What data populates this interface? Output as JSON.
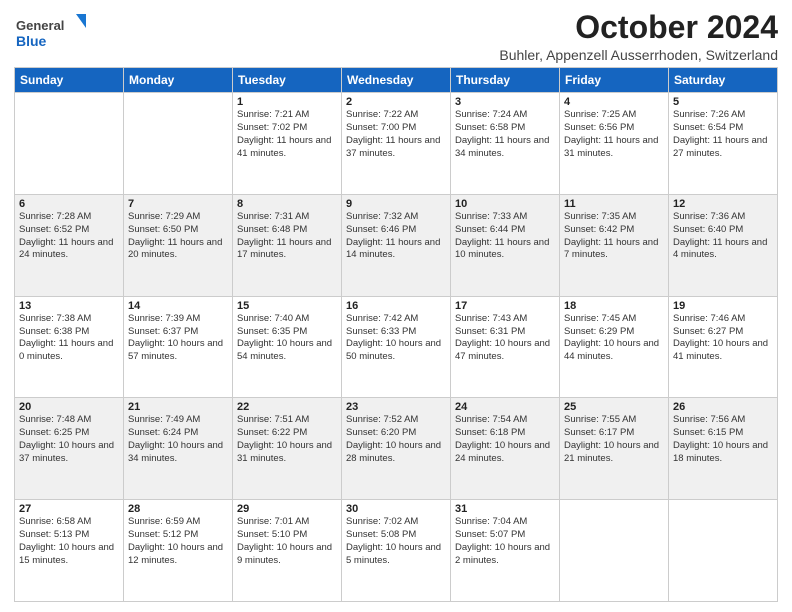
{
  "header": {
    "logo_general": "General",
    "logo_blue": "Blue",
    "month_title": "October 2024",
    "location": "Buhler, Appenzell Ausserrhoden, Switzerland"
  },
  "weekdays": [
    "Sunday",
    "Monday",
    "Tuesday",
    "Wednesday",
    "Thursday",
    "Friday",
    "Saturday"
  ],
  "weeks": [
    [
      {
        "day": "",
        "info": ""
      },
      {
        "day": "",
        "info": ""
      },
      {
        "day": "1",
        "info": "Sunrise: 7:21 AM\nSunset: 7:02 PM\nDaylight: 11 hours and 41 minutes."
      },
      {
        "day": "2",
        "info": "Sunrise: 7:22 AM\nSunset: 7:00 PM\nDaylight: 11 hours and 37 minutes."
      },
      {
        "day": "3",
        "info": "Sunrise: 7:24 AM\nSunset: 6:58 PM\nDaylight: 11 hours and 34 minutes."
      },
      {
        "day": "4",
        "info": "Sunrise: 7:25 AM\nSunset: 6:56 PM\nDaylight: 11 hours and 31 minutes."
      },
      {
        "day": "5",
        "info": "Sunrise: 7:26 AM\nSunset: 6:54 PM\nDaylight: 11 hours and 27 minutes."
      }
    ],
    [
      {
        "day": "6",
        "info": "Sunrise: 7:28 AM\nSunset: 6:52 PM\nDaylight: 11 hours and 24 minutes."
      },
      {
        "day": "7",
        "info": "Sunrise: 7:29 AM\nSunset: 6:50 PM\nDaylight: 11 hours and 20 minutes."
      },
      {
        "day": "8",
        "info": "Sunrise: 7:31 AM\nSunset: 6:48 PM\nDaylight: 11 hours and 17 minutes."
      },
      {
        "day": "9",
        "info": "Sunrise: 7:32 AM\nSunset: 6:46 PM\nDaylight: 11 hours and 14 minutes."
      },
      {
        "day": "10",
        "info": "Sunrise: 7:33 AM\nSunset: 6:44 PM\nDaylight: 11 hours and 10 minutes."
      },
      {
        "day": "11",
        "info": "Sunrise: 7:35 AM\nSunset: 6:42 PM\nDaylight: 11 hours and 7 minutes."
      },
      {
        "day": "12",
        "info": "Sunrise: 7:36 AM\nSunset: 6:40 PM\nDaylight: 11 hours and 4 minutes."
      }
    ],
    [
      {
        "day": "13",
        "info": "Sunrise: 7:38 AM\nSunset: 6:38 PM\nDaylight: 11 hours and 0 minutes."
      },
      {
        "day": "14",
        "info": "Sunrise: 7:39 AM\nSunset: 6:37 PM\nDaylight: 10 hours and 57 minutes."
      },
      {
        "day": "15",
        "info": "Sunrise: 7:40 AM\nSunset: 6:35 PM\nDaylight: 10 hours and 54 minutes."
      },
      {
        "day": "16",
        "info": "Sunrise: 7:42 AM\nSunset: 6:33 PM\nDaylight: 10 hours and 50 minutes."
      },
      {
        "day": "17",
        "info": "Sunrise: 7:43 AM\nSunset: 6:31 PM\nDaylight: 10 hours and 47 minutes."
      },
      {
        "day": "18",
        "info": "Sunrise: 7:45 AM\nSunset: 6:29 PM\nDaylight: 10 hours and 44 minutes."
      },
      {
        "day": "19",
        "info": "Sunrise: 7:46 AM\nSunset: 6:27 PM\nDaylight: 10 hours and 41 minutes."
      }
    ],
    [
      {
        "day": "20",
        "info": "Sunrise: 7:48 AM\nSunset: 6:25 PM\nDaylight: 10 hours and 37 minutes."
      },
      {
        "day": "21",
        "info": "Sunrise: 7:49 AM\nSunset: 6:24 PM\nDaylight: 10 hours and 34 minutes."
      },
      {
        "day": "22",
        "info": "Sunrise: 7:51 AM\nSunset: 6:22 PM\nDaylight: 10 hours and 31 minutes."
      },
      {
        "day": "23",
        "info": "Sunrise: 7:52 AM\nSunset: 6:20 PM\nDaylight: 10 hours and 28 minutes."
      },
      {
        "day": "24",
        "info": "Sunrise: 7:54 AM\nSunset: 6:18 PM\nDaylight: 10 hours and 24 minutes."
      },
      {
        "day": "25",
        "info": "Sunrise: 7:55 AM\nSunset: 6:17 PM\nDaylight: 10 hours and 21 minutes."
      },
      {
        "day": "26",
        "info": "Sunrise: 7:56 AM\nSunset: 6:15 PM\nDaylight: 10 hours and 18 minutes."
      }
    ],
    [
      {
        "day": "27",
        "info": "Sunrise: 6:58 AM\nSunset: 5:13 PM\nDaylight: 10 hours and 15 minutes."
      },
      {
        "day": "28",
        "info": "Sunrise: 6:59 AM\nSunset: 5:12 PM\nDaylight: 10 hours and 12 minutes."
      },
      {
        "day": "29",
        "info": "Sunrise: 7:01 AM\nSunset: 5:10 PM\nDaylight: 10 hours and 9 minutes."
      },
      {
        "day": "30",
        "info": "Sunrise: 7:02 AM\nSunset: 5:08 PM\nDaylight: 10 hours and 5 minutes."
      },
      {
        "day": "31",
        "info": "Sunrise: 7:04 AM\nSunset: 5:07 PM\nDaylight: 10 hours and 2 minutes."
      },
      {
        "day": "",
        "info": ""
      },
      {
        "day": "",
        "info": ""
      }
    ]
  ]
}
